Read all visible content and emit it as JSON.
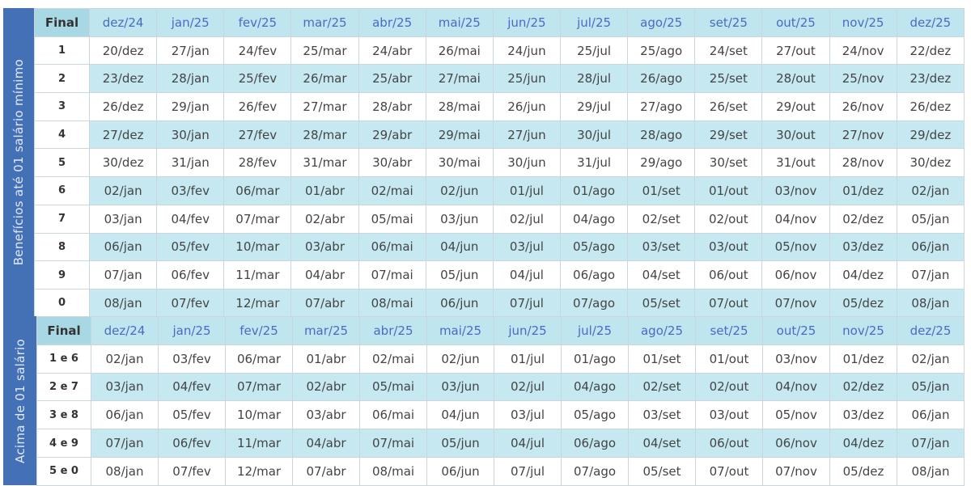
{
  "months": [
    "dez/24",
    "jan/25",
    "fev/25",
    "mar/25",
    "abr/25",
    "mai/25",
    "jun/25",
    "jul/25",
    "ago/25",
    "set/25",
    "out/25",
    "nov/25",
    "dez/25"
  ],
  "colors": {
    "sidebar": "#4470b6",
    "header": "#bfe5ef",
    "alt_row": "#c6e8f1",
    "month_text": "#4a6bc4"
  },
  "table1": {
    "side_label": "Benefícios até 01 salário mínimo",
    "final_label": "Final",
    "rows": [
      {
        "final": "1",
        "dates": [
          "20/dez",
          "27/jan",
          "24/fev",
          "25/mar",
          "24/abr",
          "26/mai",
          "24/jun",
          "25/jul",
          "25/ago",
          "24/set",
          "27/out",
          "24/nov",
          "22/dez"
        ]
      },
      {
        "final": "2",
        "dates": [
          "23/dez",
          "28/jan",
          "25/fev",
          "26/mar",
          "25/abr",
          "27/mai",
          "25/jun",
          "28/jul",
          "26/ago",
          "25/set",
          "28/out",
          "25/nov",
          "23/dez"
        ]
      },
      {
        "final": "3",
        "dates": [
          "26/dez",
          "29/jan",
          "26/fev",
          "27/mar",
          "28/abr",
          "28/mai",
          "26/jun",
          "29/jul",
          "27/ago",
          "26/set",
          "29/out",
          "26/nov",
          "26/dez"
        ]
      },
      {
        "final": "4",
        "dates": [
          "27/dez",
          "30/jan",
          "27/fev",
          "28/mar",
          "29/abr",
          "29/mai",
          "27/jun",
          "30/jul",
          "28/ago",
          "29/set",
          "30/out",
          "27/nov",
          "29/dez"
        ]
      },
      {
        "final": "5",
        "dates": [
          "30/dez",
          "31/jan",
          "28/fev",
          "31/mar",
          "30/abr",
          "30/mai",
          "30/jun",
          "31/jul",
          "29/ago",
          "30/set",
          "31/out",
          "28/nov",
          "30/dez"
        ]
      },
      {
        "final": "6",
        "dates": [
          "02/jan",
          "03/fev",
          "06/mar",
          "01/abr",
          "02/mai",
          "02/jun",
          "01/jul",
          "01/ago",
          "01/set",
          "01/out",
          "03/nov",
          "01/dez",
          "02/jan"
        ]
      },
      {
        "final": "7",
        "dates": [
          "03/jan",
          "04/fev",
          "07/mar",
          "02/abr",
          "05/mai",
          "03/jun",
          "02/jul",
          "04/ago",
          "02/set",
          "02/out",
          "04/nov",
          "02/dez",
          "05/jan"
        ]
      },
      {
        "final": "8",
        "dates": [
          "06/jan",
          "05/fev",
          "10/mar",
          "03/abr",
          "06/mai",
          "04/jun",
          "03/jul",
          "05/ago",
          "03/set",
          "03/out",
          "05/nov",
          "03/dez",
          "06/jan"
        ]
      },
      {
        "final": "9",
        "dates": [
          "07/jan",
          "06/fev",
          "11/mar",
          "04/abr",
          "07/mai",
          "05/jun",
          "04/jul",
          "06/ago",
          "04/set",
          "06/out",
          "06/nov",
          "04/dez",
          "07/jan"
        ]
      },
      {
        "final": "0",
        "dates": [
          "08/jan",
          "07/fev",
          "12/mar",
          "07/abr",
          "08/mai",
          "06/jun",
          "07/jul",
          "07/ago",
          "05/set",
          "07/out",
          "07/nov",
          "05/dez",
          "08/jan"
        ]
      }
    ]
  },
  "table2": {
    "side_label": "Acima de 01 salário",
    "final_label": "Final",
    "rows": [
      {
        "final": "1 e 6",
        "dates": [
          "02/jan",
          "03/fev",
          "06/mar",
          "01/abr",
          "02/mai",
          "02/jun",
          "01/jul",
          "01/ago",
          "01/set",
          "01/out",
          "03/nov",
          "01/dez",
          "02/jan"
        ]
      },
      {
        "final": "2 e 7",
        "dates": [
          "03/jan",
          "04/fev",
          "07/mar",
          "02/abr",
          "05/mai",
          "03/jun",
          "02/jul",
          "04/ago",
          "02/set",
          "02/out",
          "04/nov",
          "02/dez",
          "05/jan"
        ]
      },
      {
        "final": "3 e 8",
        "dates": [
          "06/jan",
          "05/fev",
          "10/mar",
          "03/abr",
          "06/mai",
          "04/jun",
          "03/jul",
          "05/ago",
          "03/set",
          "03/out",
          "05/nov",
          "03/dez",
          "06/jan"
        ]
      },
      {
        "final": "4 e 9",
        "dates": [
          "07/jan",
          "06/fev",
          "11/mar",
          "04/abr",
          "07/mai",
          "05/jun",
          "04/jul",
          "06/ago",
          "04/set",
          "06/out",
          "06/nov",
          "04/dez",
          "07/jan"
        ]
      },
      {
        "final": "5 e 0",
        "dates": [
          "08/jan",
          "07/fev",
          "12/mar",
          "07/abr",
          "08/mai",
          "06/jun",
          "07/jul",
          "07/ago",
          "05/set",
          "07/out",
          "07/nov",
          "05/dez",
          "08/jan"
        ]
      }
    ]
  }
}
